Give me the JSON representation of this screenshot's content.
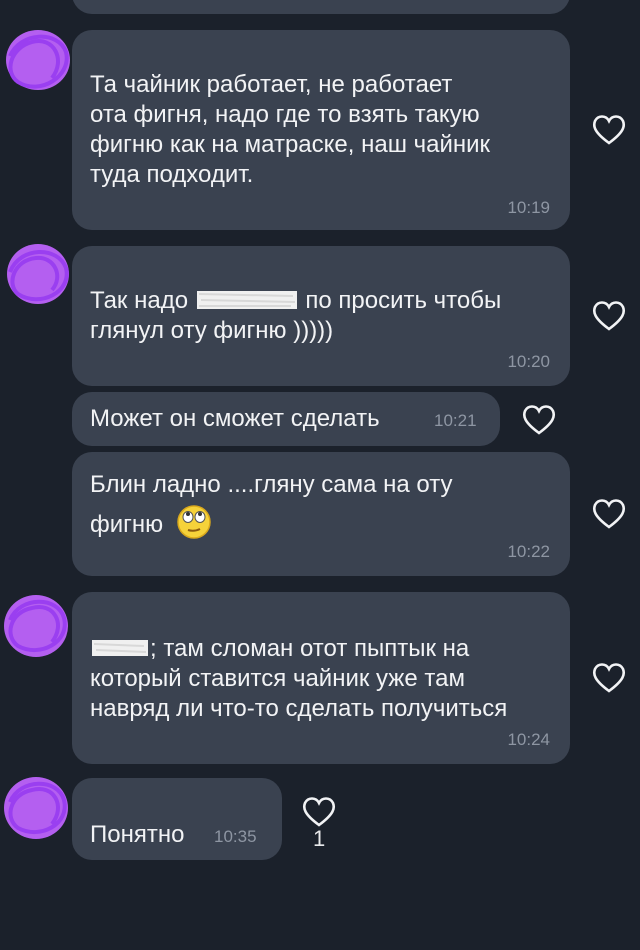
{
  "messages": [
    {
      "id": "m1",
      "lines": [
        "Та чайник работает, не работает",
        "ота фигня, надо где то взять такую",
        "фигню как на матраске, наш чайник",
        "туда подходит."
      ],
      "time": "10:19"
    },
    {
      "id": "m2",
      "text_before": "Так надо",
      "text_after": "по просить чтобы",
      "line2": "глянул оту фигню )))))",
      "time": "10:20"
    },
    {
      "id": "m3",
      "text": "Может он сможет сделать",
      "time": "10:21"
    },
    {
      "id": "m4",
      "line1": "Блин ладно ....гляну сама на оту",
      "line2": "фигню",
      "emoji": "🙄",
      "time": "10:22"
    },
    {
      "id": "m5",
      "line1_after": "; там сломан отот пыптык на",
      "line2": "который ставится чайник уже там",
      "line3": "навряд ли что-то сделать получиться",
      "time": "10:24"
    },
    {
      "id": "m6",
      "text": "Понятно",
      "time": "10:35",
      "likes": "1"
    }
  ],
  "icons": {
    "like": "heart-icon",
    "avatar": "avatar-scribble",
    "emoji": "rolling-eyes-emoji"
  },
  "colors": {
    "background": "#1b212b",
    "bubble": "#3a4250",
    "redaction": "#c860f0",
    "time": "#8e96a3"
  }
}
